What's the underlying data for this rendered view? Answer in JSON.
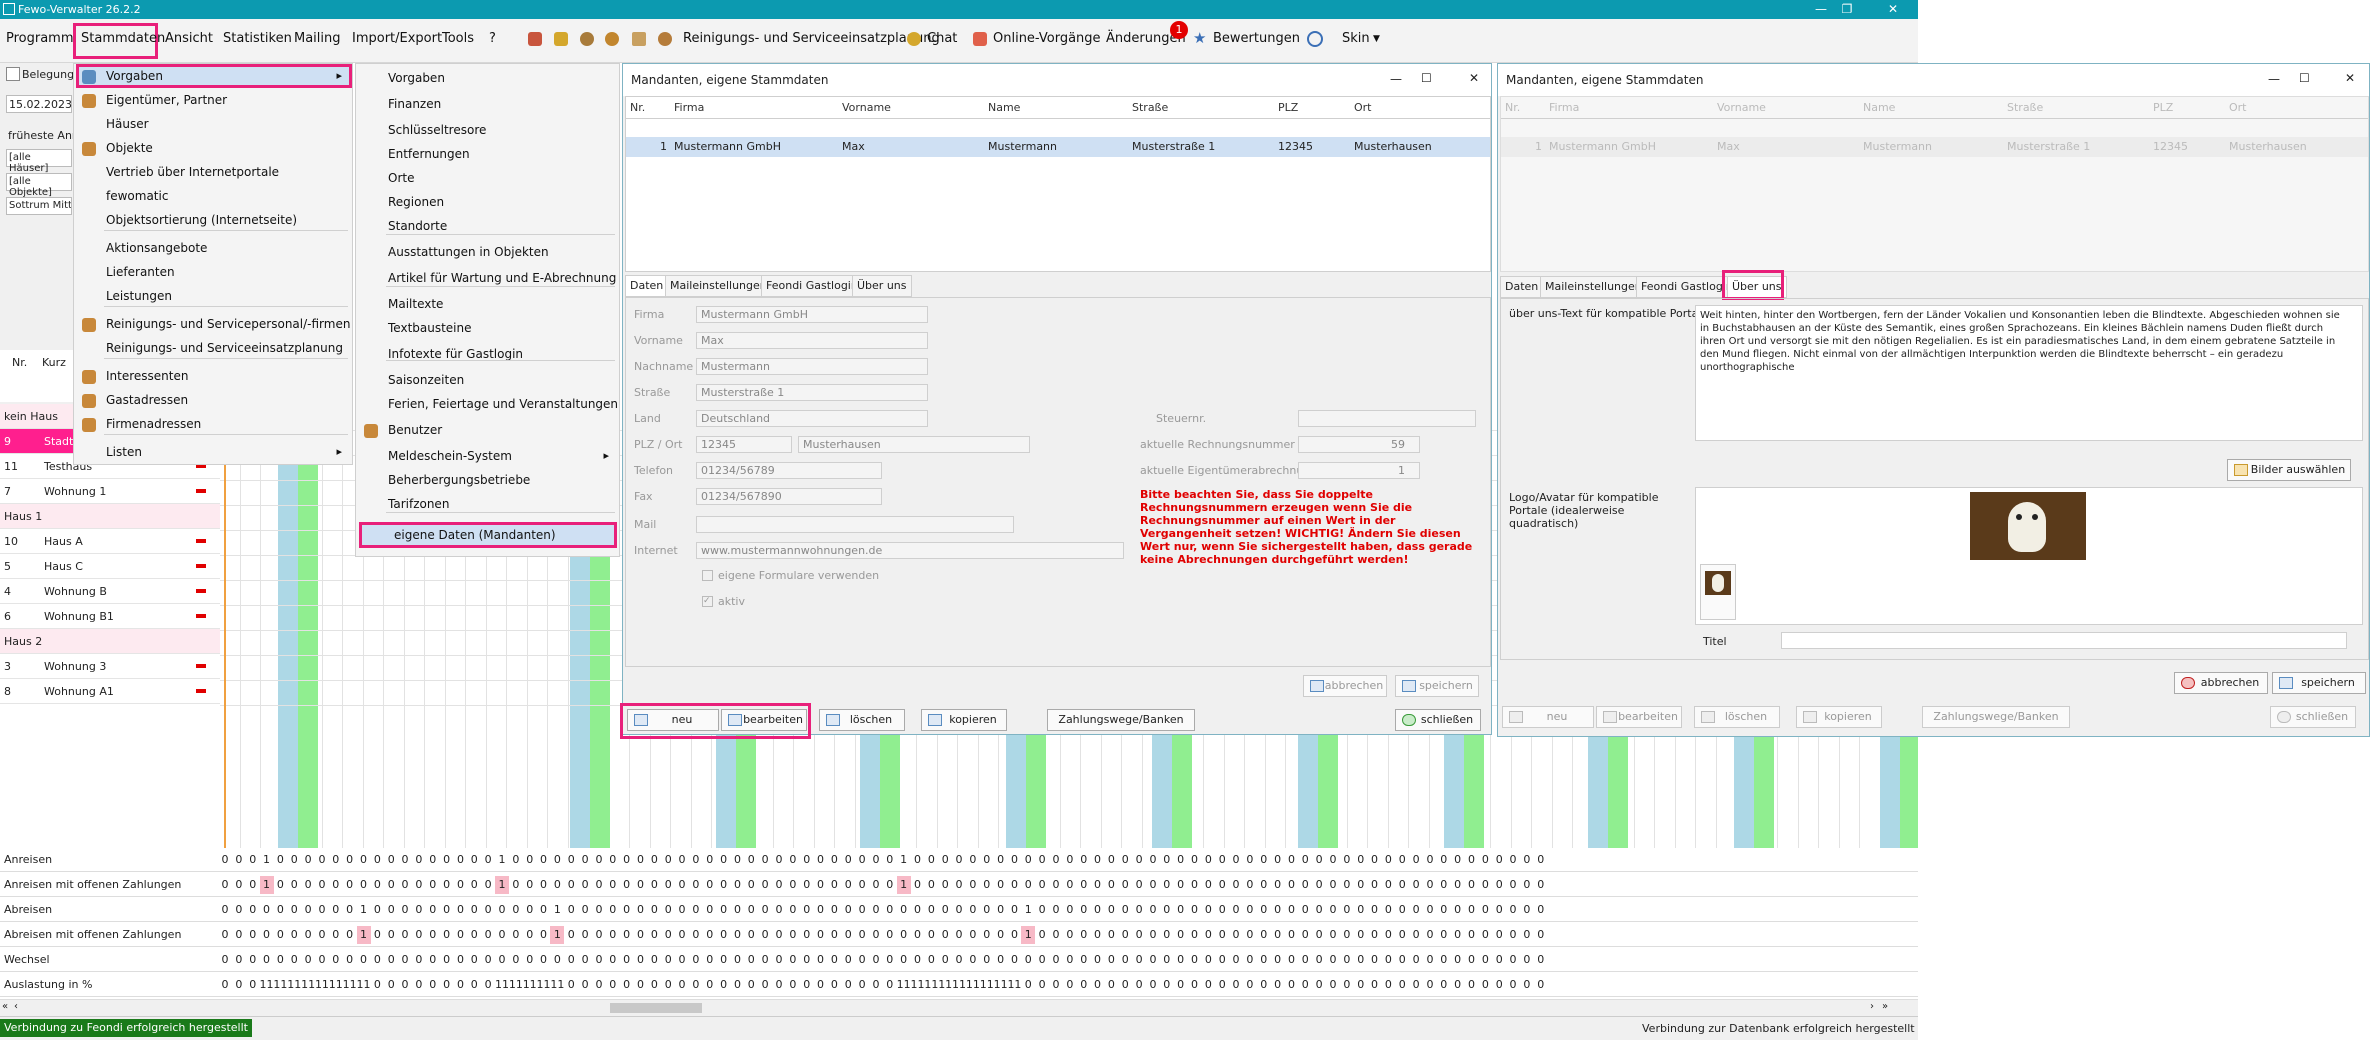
{
  "app": {
    "title": "Fewo-Verwalter 26.2.2"
  },
  "menubar": {
    "items": [
      "Programm",
      "Stammdaten",
      "Ansicht",
      "Statistiken",
      "Mailing",
      "Import/Export",
      "Tools",
      "?"
    ],
    "toolbar_planning": "Reinigungs- und Serviceeinsatzplanung",
    "chat": "Chat",
    "online": "Online-Vorgänge",
    "changes": "Änderungen",
    "changes_badge": "1",
    "ratings": "Bewertungen",
    "skin": "Skin"
  },
  "stammdaten_menu": {
    "items": [
      "Vorgaben",
      "Eigentümer, Partner",
      "Häuser",
      "Objekte",
      "Vertrieb über Internetportale",
      "fewomatic",
      "Objektsortierung (Internetseite)",
      "Aktionsangebote",
      "Lieferanten",
      "Leistungen",
      "Reinigungs- und Servicepersonal/-firmen",
      "Reinigungs- und Serviceeinsatzplanung",
      "Interessenten",
      "Gastadressen",
      "Firmenadressen",
      "Listen"
    ]
  },
  "vorgaben_menu": {
    "items": [
      "Vorgaben",
      "Finanzen",
      "Schlüsseltresore",
      "Entfernungen",
      "Orte",
      "Regionen",
      "Standorte",
      "Ausstattungen in Objekten",
      "Artikel für Wartung und E-Abrechnung",
      "Mailtexte",
      "Textbausteine",
      "Infotexte für Gastlogin",
      "Saisonzeiten",
      "Ferien, Feiertage und Veranstaltungen",
      "Benutzer",
      "Meldeschein-System",
      "Beherbergungsbetriebe",
      "Tarifzonen",
      "eigene Daten (Mandanten)"
    ]
  },
  "left_panel": {
    "tab": "Belegung",
    "date": "15.02.2023",
    "earliest": "früheste Anrei",
    "houses": "[alle Häuser]",
    "objects": "[alle Objekte]",
    "sort": "Sottrum Mitte",
    "col_nr": "Nr.",
    "col_kurz": "Kurz",
    "rows": [
      {
        "nr": "kein Haus",
        "name": "",
        "type": "group"
      },
      {
        "nr": "9",
        "name": "Stadt",
        "type": "sel"
      },
      {
        "nr": "11",
        "name": "Testhaus",
        "type": "row"
      },
      {
        "nr": "7",
        "name": "Wohnung 1",
        "type": "row"
      },
      {
        "nr": "Haus 1",
        "name": "",
        "type": "group"
      },
      {
        "nr": "10",
        "name": "Haus A",
        "type": "row"
      },
      {
        "nr": "5",
        "name": "Haus C",
        "type": "row"
      },
      {
        "nr": "4",
        "name": "Wohnung B",
        "type": "row"
      },
      {
        "nr": "6",
        "name": "Wohnung B1",
        "type": "row"
      },
      {
        "nr": "Haus 2",
        "name": "",
        "type": "group"
      },
      {
        "nr": "3",
        "name": "Wohnung 3",
        "type": "row"
      },
      {
        "nr": "8",
        "name": "Wohnung A1",
        "type": "row"
      }
    ]
  },
  "dialog1": {
    "title": "Mandanten, eigene Stammdaten",
    "columns": [
      "Nr.",
      "Firma",
      "Vorname",
      "Name",
      "Straße",
      "PLZ",
      "Ort"
    ],
    "row": [
      "1",
      "Mustermann GmbH",
      "Max",
      "Mustermann",
      "Musterstraße 1",
      "12345",
      "Musterhausen"
    ],
    "tabs": [
      "Daten",
      "Maileinstellungen",
      "Feondi Gastlogin",
      "Über uns"
    ],
    "labels": {
      "firma": "Firma",
      "vorname": "Vorname",
      "nachname": "Nachname",
      "strasse": "Straße",
      "land": "Land",
      "plzort": "PLZ / Ort",
      "telefon": "Telefon",
      "fax": "Fax",
      "mail": "Mail",
      "internet": "Internet",
      "steuer": "Steuernr.",
      "rechnung": "aktuelle Rechnungsnummer",
      "eigentuemer": "aktuelle Eigentümerabrechnung",
      "formulare": "eigene Formulare verwenden",
      "aktiv": "aktiv"
    },
    "values": {
      "firma": "Mustermann GmbH",
      "vorname": "Max",
      "nachname": "Mustermann",
      "strasse": "Musterstraße 1",
      "land": "Deutschland",
      "plz": "12345",
      "ort": "Musterhausen",
      "telefon": "01234/56789",
      "fax": "01234/567890",
      "internet": "www.mustermannwohnungen.de",
      "rechnung": "59",
      "eigentuemer": "1"
    },
    "warning": "Bitte beachten Sie, dass Sie doppelte Rechnungsnummern erzeugen wenn Sie die Rechnungsnummer auf einen Wert in der Vergangenheit setzen! WICHTIG! Ändern Sie diesen Wert nur, wenn Sie sichergestellt haben, dass gerade keine Abrechnungen durchgeführt werden!",
    "buttons": {
      "abbrechen": "abbrechen",
      "speichern": "speichern",
      "neu": "neu",
      "bearbeiten": "bearbeiten",
      "loeschen": "löschen",
      "kopieren": "kopieren",
      "zahlung": "Zahlungswege/Banken",
      "schliessen": "schließen"
    }
  },
  "dialog2": {
    "title": "Mandanten, eigene Stammdaten",
    "columns": [
      "Nr.",
      "Firma",
      "Vorname",
      "Name",
      "Straße",
      "PLZ",
      "Ort"
    ],
    "row": [
      "1",
      "Mustermann GmbH",
      "Max",
      "Mustermann",
      "Musterstraße 1",
      "12345",
      "Musterhausen"
    ],
    "tabs": [
      "Daten",
      "Maileinstellungen",
      "Feondi Gastlogin",
      "Über uns"
    ],
    "ueber_label": "über uns-Text für kompatible Portale",
    "ueber_text": "Weit hinten, hinter den Wortbergen, fern der Länder Vokalien und Konsonantien leben die Blindtexte. Abgeschieden wohnen sie in Buchstabhausen an der Küste des Semantik, eines großen Sprachozeans. Ein kleines Bächlein namens Duden fließt durch ihren Ort und versorgt sie mit den nötigen Regelialien. Es ist ein paradiesmatisches Land, in dem einem gebratene Satzteile in den Mund fliegen. Nicht einmal von der allmächtigen Interpunktion werden die Blindtexte beherrscht – ein geradezu unorthographische",
    "bilder": "Bilder auswählen",
    "logo_label": "Logo/Avatar für kompatible Portale (idealerweise quadratisch)",
    "titel": "Titel",
    "buttons": {
      "abbrechen": "abbrechen",
      "speichern": "speichern",
      "neu": "neu",
      "bearbeiten": "bearbeiten",
      "loeschen": "löschen",
      "kopieren": "kopieren",
      "zahlung": "Zahlungswege/Banken",
      "schliessen": "schließen"
    }
  },
  "stats": {
    "rows": [
      {
        "label": "Anreisen",
        "values": [
          0,
          0,
          0,
          1,
          0,
          0,
          0,
          0,
          0,
          0,
          0,
          0,
          0,
          0,
          0,
          0,
          0,
          0,
          0,
          0,
          1,
          0,
          0,
          0,
          0,
          0,
          0,
          0,
          0,
          0,
          0,
          0,
          0,
          0,
          0,
          0,
          0,
          0,
          0,
          0,
          0,
          0,
          0,
          0,
          0,
          0,
          0,
          0,
          0,
          1,
          0,
          0,
          0,
          0,
          0,
          0,
          0,
          0,
          0,
          0,
          0,
          0,
          0,
          0,
          0,
          0,
          0,
          0,
          0,
          0,
          0,
          0,
          0,
          0,
          0,
          0,
          0,
          0,
          0,
          0,
          0,
          0,
          0,
          0,
          0,
          0,
          0,
          0,
          0,
          0,
          0,
          0,
          0,
          0,
          0,
          0
        ],
        "hi": []
      },
      {
        "label": "Anreisen mit offenen Zahlungen",
        "values": [
          0,
          0,
          0,
          1,
          0,
          0,
          0,
          0,
          0,
          0,
          0,
          0,
          0,
          0,
          0,
          0,
          0,
          0,
          0,
          0,
          1,
          0,
          0,
          0,
          0,
          0,
          0,
          0,
          0,
          0,
          0,
          0,
          0,
          0,
          0,
          0,
          0,
          0,
          0,
          0,
          0,
          0,
          0,
          0,
          0,
          0,
          0,
          0,
          0,
          1,
          0,
          0,
          0,
          0,
          0,
          0,
          0,
          0,
          0,
          0,
          0,
          0,
          0,
          0,
          0,
          0,
          0,
          0,
          0,
          0,
          0,
          0,
          0,
          0,
          0,
          0,
          0,
          0,
          0,
          0,
          0,
          0,
          0,
          0,
          0,
          0,
          0,
          0,
          0,
          0,
          0,
          0,
          0,
          0,
          0,
          0
        ],
        "hi": [
          3,
          20,
          49
        ]
      },
      {
        "label": "Abreisen",
        "values": [
          0,
          0,
          0,
          0,
          0,
          0,
          0,
          0,
          0,
          0,
          1,
          0,
          0,
          0,
          0,
          0,
          0,
          0,
          0,
          0,
          0,
          0,
          0,
          0,
          1,
          0,
          0,
          0,
          0,
          0,
          0,
          0,
          0,
          0,
          0,
          0,
          0,
          0,
          0,
          0,
          0,
          0,
          0,
          0,
          0,
          0,
          0,
          0,
          0,
          0,
          0,
          0,
          0,
          0,
          0,
          0,
          0,
          0,
          1,
          0,
          0,
          0,
          0,
          0,
          0,
          0,
          0,
          0,
          0,
          0,
          0,
          0,
          0,
          0,
          0,
          0,
          0,
          0,
          0,
          0,
          0,
          0,
          0,
          0,
          0,
          0,
          0,
          0,
          0,
          0,
          0,
          0,
          0,
          0,
          0,
          0
        ],
        "hi": []
      },
      {
        "label": "Abreisen mit offenen Zahlungen",
        "values": [
          0,
          0,
          0,
          0,
          0,
          0,
          0,
          0,
          0,
          0,
          1,
          0,
          0,
          0,
          0,
          0,
          0,
          0,
          0,
          0,
          0,
          0,
          0,
          0,
          1,
          0,
          0,
          0,
          0,
          0,
          0,
          0,
          0,
          0,
          0,
          0,
          0,
          0,
          0,
          0,
          0,
          0,
          0,
          0,
          0,
          0,
          0,
          0,
          0,
          0,
          0,
          0,
          0,
          0,
          0,
          0,
          0,
          0,
          1,
          0,
          0,
          0,
          0,
          0,
          0,
          0,
          0,
          0,
          0,
          0,
          0,
          0,
          0,
          0,
          0,
          0,
          0,
          0,
          0,
          0,
          0,
          0,
          0,
          0,
          0,
          0,
          0,
          0,
          0,
          0,
          0,
          0,
          0,
          0,
          0,
          0
        ],
        "hi": [
          10,
          24,
          58
        ]
      },
      {
        "label": "Wechsel",
        "values": [
          0,
          0,
          0,
          0,
          0,
          0,
          0,
          0,
          0,
          0,
          0,
          0,
          0,
          0,
          0,
          0,
          0,
          0,
          0,
          0,
          0,
          0,
          0,
          0,
          0,
          0,
          0,
          0,
          0,
          0,
          0,
          0,
          0,
          0,
          0,
          0,
          0,
          0,
          0,
          0,
          0,
          0,
          0,
          0,
          0,
          0,
          0,
          0,
          0,
          0,
          0,
          0,
          0,
          0,
          0,
          0,
          0,
          0,
          0,
          0,
          0,
          0,
          0,
          0,
          0,
          0,
          0,
          0,
          0,
          0,
          0,
          0,
          0,
          0,
          0,
          0,
          0,
          0,
          0,
          0,
          0,
          0,
          0,
          0,
          0,
          0,
          0,
          0,
          0,
          0,
          0,
          0,
          0,
          0,
          0,
          0
        ],
        "hi": []
      },
      {
        "label": "Auslastung in %",
        "values": [
          0,
          0,
          0,
          11,
          11,
          11,
          11,
          11,
          11,
          11,
          11,
          0,
          0,
          0,
          0,
          0,
          0,
          0,
          0,
          0,
          11,
          11,
          11,
          11,
          11,
          0,
          0,
          0,
          0,
          0,
          0,
          0,
          0,
          0,
          0,
          0,
          0,
          0,
          0,
          0,
          0,
          0,
          0,
          0,
          0,
          0,
          0,
          0,
          0,
          11,
          11,
          11,
          11,
          11,
          11,
          11,
          11,
          11,
          0,
          0,
          0,
          0,
          0,
          0,
          0,
          0,
          0,
          0,
          0,
          0,
          0,
          0,
          0,
          0,
          0,
          0,
          0,
          0,
          0,
          0,
          0,
          0,
          0,
          0,
          0,
          0,
          0,
          0,
          0,
          0,
          0,
          0,
          0,
          0,
          0,
          0
        ],
        "hi": []
      }
    ]
  },
  "statusbar": {
    "left": "Verbindung zu Feondi erfolgreich hergestellt",
    "right": "Verbindung zur Datenbank erfolgreich hergestellt"
  },
  "colors": {
    "accent": "#e8207a",
    "titlebar": "#0c9ab0",
    "menuhl": "#3b6fb6",
    "blue_col": "#add8e6",
    "green_col": "#90ee90"
  }
}
